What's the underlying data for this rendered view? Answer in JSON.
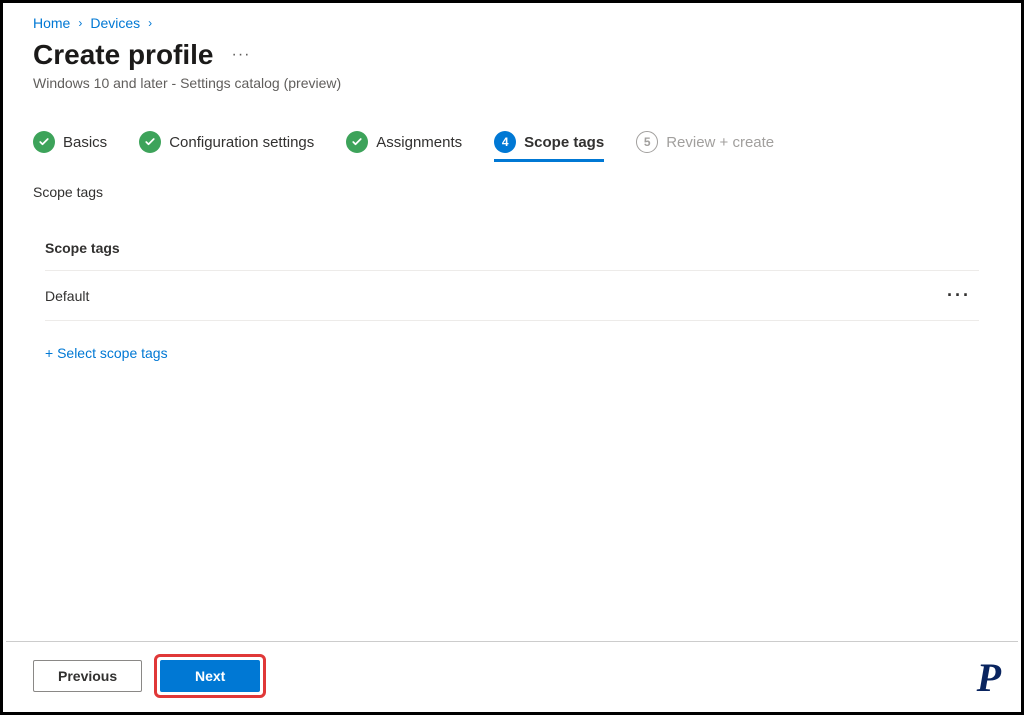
{
  "breadcrumb": {
    "home": "Home",
    "devices": "Devices"
  },
  "header": {
    "title": "Create profile",
    "subtitle": "Windows 10 and later - Settings catalog (preview)"
  },
  "stepper": {
    "basics": "Basics",
    "config": "Configuration settings",
    "assignments": "Assignments",
    "scope_tags": "Scope tags",
    "scope_tags_num": "4",
    "review": "Review + create",
    "review_num": "5"
  },
  "section": {
    "label": "Scope tags",
    "table_header": "Scope tags",
    "rows": [
      "Default"
    ],
    "add_link": "+ Select scope tags"
  },
  "footer": {
    "previous": "Previous",
    "next": "Next"
  }
}
